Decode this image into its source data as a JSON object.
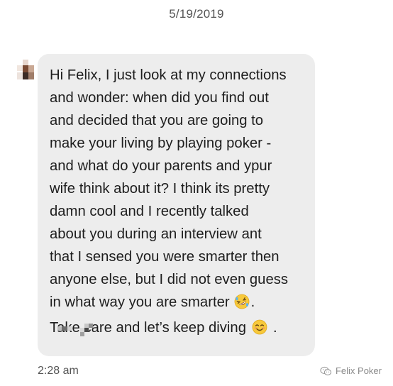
{
  "header": {
    "date": "5/19/2019"
  },
  "message": {
    "lines": [
      "Hi Felix, I just look at my connections",
      "and wonder: when did you find out",
      "and decided that you are going to",
      "make your living by playing poker -",
      "and what do your parents and ypur",
      "wife think about it? I think its pretty",
      "damn cool and I recently talked",
      "about you during an interview ant",
      "that I sensed you were smarter then",
      "anyone else, but I did not even guess",
      "in what way you are smarter",
      "Take care and let’s keep diving"
    ],
    "line_11_suffix": ".",
    "line_12_suffix": ".",
    "emoji_1": "rolling-on-floor-laughing-emoji",
    "emoji_2": "smiling-face-emoji",
    "timestamp": "2:28 am"
  },
  "watermark": {
    "text": "Felix Poker",
    "icon": "wechat-icon"
  },
  "colors": {
    "bubble": "#ededed",
    "text": "#1e1e1e",
    "meta_text": "#555555",
    "watermark": "#8a8a8a"
  }
}
